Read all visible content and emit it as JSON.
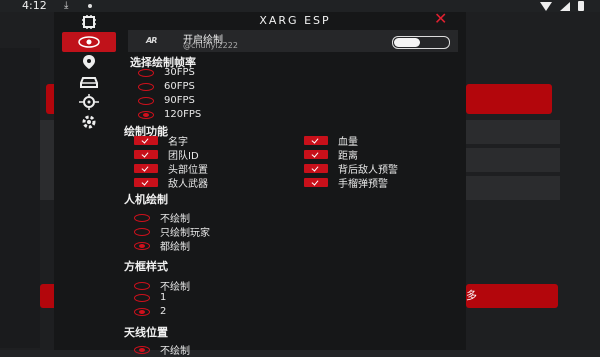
{
  "status": {
    "time": "4:12",
    "download_icon": "download-icon"
  },
  "background": {
    "button_label": "多"
  },
  "menu": {
    "title": "XARG ESP",
    "sidebar": [
      {
        "icon": "chip-icon"
      },
      {
        "icon": "eye-icon",
        "active": true
      },
      {
        "icon": "map-pin-icon"
      },
      {
        "icon": "car-icon"
      },
      {
        "icon": "crosshair-icon"
      },
      {
        "icon": "gear-icon"
      }
    ],
    "user": {
      "logo": "AR",
      "toggle_label": "开启绘制",
      "handle": "@chunyi2222",
      "toggle_on": false
    },
    "fps": {
      "heading": "选择绘制帧率",
      "options": [
        {
          "label": "30FPS",
          "selected": false
        },
        {
          "label": "60FPS",
          "selected": false
        },
        {
          "label": "90FPS",
          "selected": false
        },
        {
          "label": "120FPS",
          "selected": true
        }
      ]
    },
    "features": {
      "heading": "绘制功能",
      "items": [
        {
          "label": "名字",
          "checked": true
        },
        {
          "label": "血量",
          "checked": true
        },
        {
          "label": "团队ID",
          "checked": true
        },
        {
          "label": "距离",
          "checked": true
        },
        {
          "label": "头部位置",
          "checked": true
        },
        {
          "label": "背后敌人预警",
          "checked": true
        },
        {
          "label": "敌人武器",
          "checked": true
        },
        {
          "label": "手榴弹预警",
          "checked": true
        }
      ]
    },
    "bots": {
      "heading": "人机绘制",
      "options": [
        {
          "label": "不绘制",
          "selected": false
        },
        {
          "label": "只绘制玩家",
          "selected": false
        },
        {
          "label": "都绘制",
          "selected": true
        }
      ]
    },
    "box": {
      "heading": "方框样式",
      "options": [
        {
          "label": "不绘制",
          "selected": false
        },
        {
          "label": "1",
          "selected": false
        },
        {
          "label": "2",
          "selected": true
        }
      ]
    },
    "antenna": {
      "heading": "天线位置",
      "options": [
        {
          "label": "不绘制",
          "selected": true
        }
      ]
    }
  }
}
